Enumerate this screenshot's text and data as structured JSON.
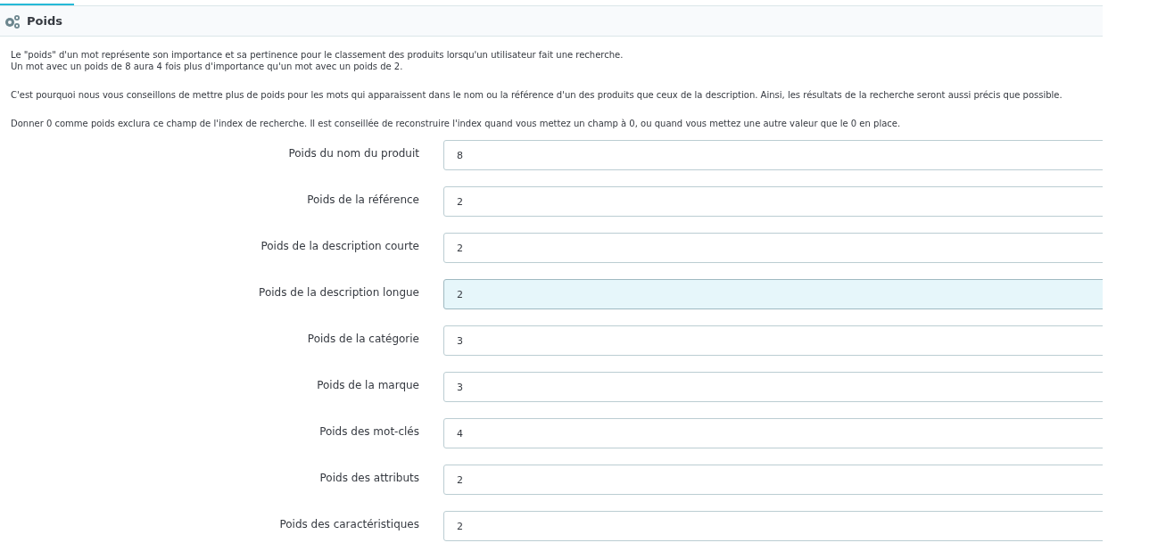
{
  "panel": {
    "title": "Poids"
  },
  "help": {
    "paragraphs": [
      [
        "Le \"poids\" d'un mot représente son importance et sa pertinence pour le classement des produits lorsqu'un utilisateur fait une recherche.",
        "Un mot avec un poids de 8 aura 4 fois plus d'importance qu'un mot avec un poids de 2."
      ],
      [
        "C'est pourquoi nous vous conseillons de mettre plus de poids pour les mots qui apparaissent dans le nom ou la référence d'un des produits que ceux de la description. Ainsi, les résultats de la recherche seront aussi précis que possible."
      ],
      [
        "Donner 0 comme poids exclura ce champ de l'index de recherche. Il est conseillée de reconstruire l'index quand vous mettez un champ à 0, ou quand vous mettez une autre valeur que le 0 en place."
      ]
    ]
  },
  "fields": [
    {
      "label": "Poids du nom du produit",
      "value": "8",
      "focused": false
    },
    {
      "label": "Poids de la référence",
      "value": "2",
      "focused": false
    },
    {
      "label": "Poids de la description courte",
      "value": "2",
      "focused": false
    },
    {
      "label": "Poids de la description longue",
      "value": "2",
      "focused": true
    },
    {
      "label": "Poids de la catégorie",
      "value": "3",
      "focused": false
    },
    {
      "label": "Poids de la marque",
      "value": "3",
      "focused": false
    },
    {
      "label": "Poids des mot-clés",
      "value": "4",
      "focused": false
    },
    {
      "label": "Poids des attributs",
      "value": "2",
      "focused": false
    },
    {
      "label": "Poids des caractéristiques",
      "value": "2",
      "focused": false
    }
  ]
}
